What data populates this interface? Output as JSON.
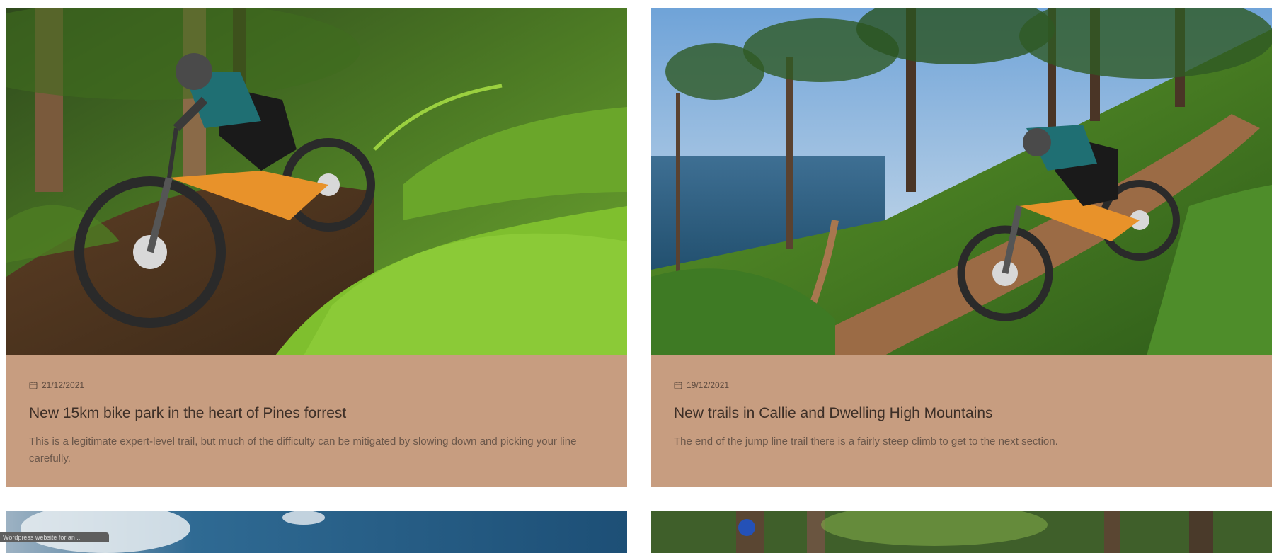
{
  "posts": [
    {
      "date": "21/12/2021",
      "title": "New 15km bike park in the heart of Pines forrest",
      "excerpt": "This is a legitimate expert-level trail, but much of the difficulty can be mitigated by slowing down and picking your line carefully.",
      "image_alt": "Rider on orange e-MTB in fern forest"
    },
    {
      "date": "19/12/2021",
      "title": "New trails in Callie and Dwelling High Mountains",
      "excerpt": "The end of the jump line trail there is a fairly steep climb to get to the next section.",
      "image_alt": "Rider descending coastal pine forest trail"
    }
  ],
  "lower_row": [
    {
      "image_alt": "Cloudy mountain sky"
    },
    {
      "image_alt": "Forest with trees"
    }
  ],
  "status_badge": "Wordpress website for an ..",
  "icons": {
    "date": "calendar-icon"
  },
  "colors": {
    "card_body": "#c79d80",
    "title": "#3d2f27",
    "excerpt": "#6b574a"
  }
}
